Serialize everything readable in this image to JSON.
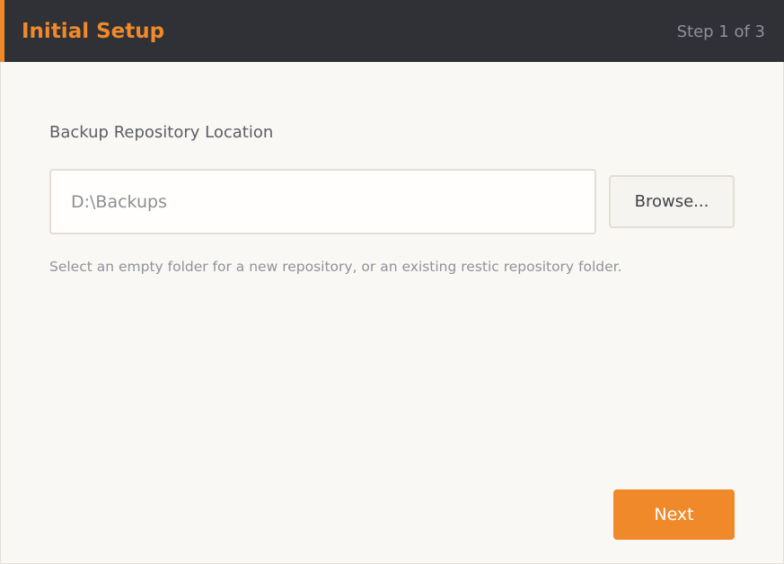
{
  "header": {
    "title": "Initial Setup",
    "step": "Step 1 of 3"
  },
  "repository": {
    "label": "Backup Repository Location",
    "path_value": "D:\\Backups",
    "browse_label": "Browse...",
    "hint": "Select an empty folder for a new repository, or an existing restic repository folder."
  },
  "actions": {
    "next_label": "Next"
  },
  "colors": {
    "accent": "#f0892a",
    "header_bg": "#2f3137",
    "content_bg": "#faf8f5"
  }
}
